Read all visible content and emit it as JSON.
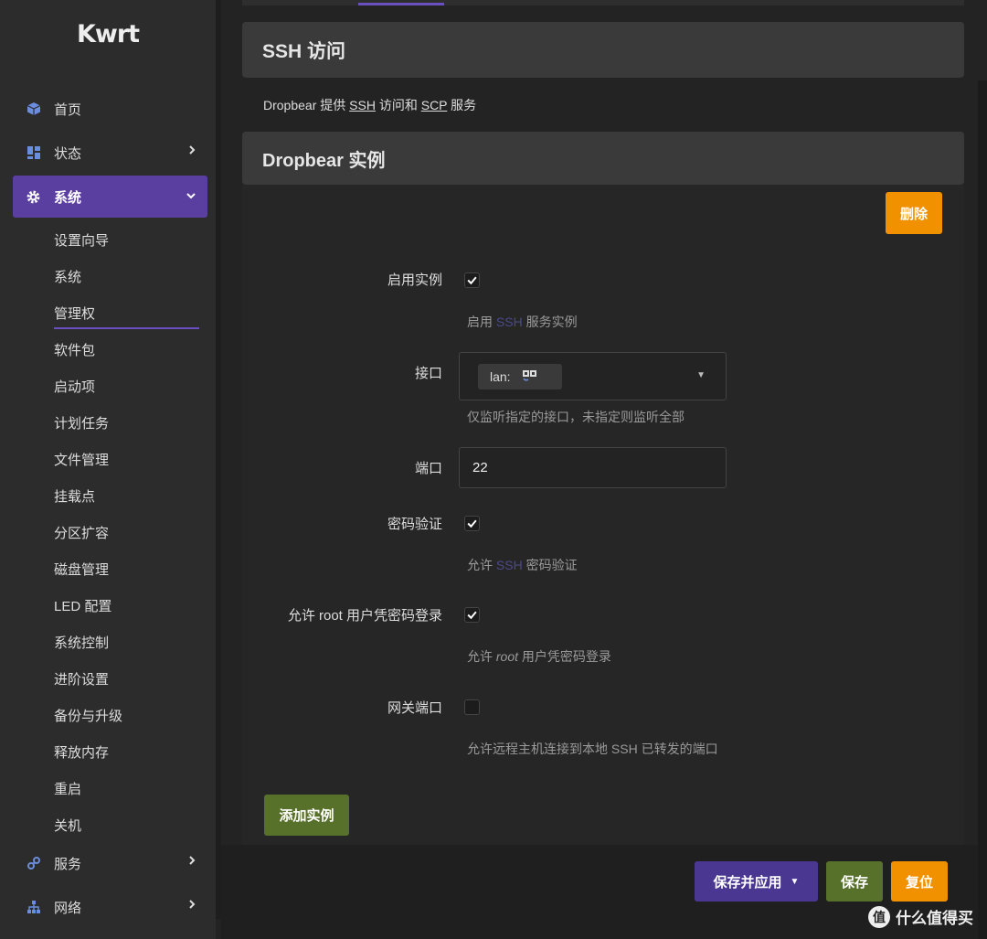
{
  "app": {
    "logo": "Kwrt"
  },
  "sidebar": {
    "top_items": [
      {
        "label": "首页",
        "icon": "cube-icon"
      },
      {
        "label": "状态",
        "icon": "dashboard-icon"
      },
      {
        "label": "系统",
        "icon": "gear-icon"
      },
      {
        "label": "服务",
        "icon": "services-icon"
      },
      {
        "label": "网络",
        "icon": "network-icon"
      }
    ],
    "system_sub": [
      "设置向导",
      "系统",
      "管理权",
      "软件包",
      "启动项",
      "计划任务",
      "文件管理",
      "挂载点",
      "分区扩容",
      "磁盘管理",
      "LED 配置",
      "系统控制",
      "进阶设置",
      "备份与升级",
      "释放内存",
      "重启",
      "关机"
    ]
  },
  "page": {
    "title": "SSH 访问",
    "desc_prefix": "Dropbear 提供 ",
    "desc_ssh": "SSH",
    "desc_mid": " 访问和 ",
    "desc_scp": "SCP",
    "desc_suffix": " 服务",
    "section_title": "Dropbear 实例",
    "delete_label": "删除",
    "add_instance_label": "添加实例"
  },
  "form": {
    "enable": {
      "label": "启用实例",
      "checked": true,
      "hint_prefix": "启用 ",
      "hint_link": "SSH",
      "hint_suffix": " 服务实例"
    },
    "interface": {
      "label": "接口",
      "chip": "lan:",
      "hint": "仅监听指定的接口，未指定则监听全部"
    },
    "port": {
      "label": "端口",
      "value": "22"
    },
    "password_auth": {
      "label": "密码验证",
      "checked": true,
      "hint_prefix": "允许 ",
      "hint_link": "SSH",
      "hint_suffix": " 密码验证"
    },
    "root_password": {
      "label": "允许 root 用户凭密码登录",
      "checked": true,
      "hint_prefix": "允许 ",
      "hint_em": "root",
      "hint_suffix": " 用户凭密码登录"
    },
    "gateway_ports": {
      "label": "网关端口",
      "checked": false,
      "hint": "允许远程主机连接到本地 SSH 已转发的端口"
    }
  },
  "footer": {
    "save_apply": "保存并应用",
    "save": "保存",
    "reset": "复位"
  },
  "watermark": {
    "logo": "值",
    "text": "什么值得买"
  },
  "colors": {
    "accent": "#5b3fa0",
    "orange": "#f29100",
    "green": "#57702a"
  }
}
